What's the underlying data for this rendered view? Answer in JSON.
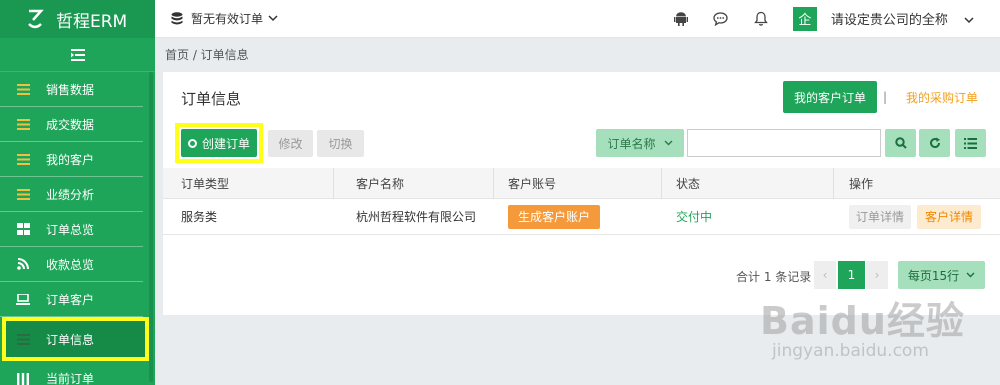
{
  "app": {
    "logo_mark": "ح",
    "logo_text": "哲程ERM"
  },
  "topbar": {
    "orders_label": "暂无有效订单",
    "avatar_char": "企",
    "company_name": "请设定贵公司的全称"
  },
  "sidebar": {
    "items": [
      {
        "label": "销售数据",
        "icon": "menu-lines-icon"
      },
      {
        "label": "成交数据",
        "icon": "menu-lines-icon"
      },
      {
        "label": "我的客户",
        "icon": "menu-lines-icon"
      },
      {
        "label": "业绩分析",
        "icon": "menu-lines-icon"
      },
      {
        "label": "订单总览",
        "icon": "grid-icon"
      },
      {
        "label": "收款总览",
        "icon": "rss-icon"
      },
      {
        "label": "订单客户",
        "icon": "laptop-icon"
      },
      {
        "label": "订单信息",
        "icon": "menu-lines-icon",
        "active": true
      },
      {
        "label": "当前订单",
        "icon": "columns-icon"
      }
    ]
  },
  "breadcrumb": "首页 / 订单信息",
  "panel": {
    "title": "订单信息",
    "my_customer_orders": "我的客户订单",
    "separator": "|",
    "my_purchase_orders": "我的采购订单",
    "create_order": "创建订单",
    "edit": "修改",
    "switch": "切换",
    "search_field": "订单名称",
    "search_value": ""
  },
  "table": {
    "headers": [
      "订单类型",
      "客户名称",
      "客户账号",
      "状态",
      "操作"
    ],
    "rows": [
      {
        "type": "服务类",
        "customer": "杭州哲程软件有限公司",
        "account_action": "生成客户账户",
        "status": "交付中",
        "action_detail": "订单详情",
        "action_customer": "客户详情"
      }
    ]
  },
  "pagination": {
    "total": "合计 1 条记录",
    "prev": "‹",
    "page": "1",
    "next": "›",
    "page_size": "每页15行"
  },
  "watermark": {
    "logo": "Baidu经验",
    "url": "jingyan.baidu.com"
  },
  "colors": {
    "primary": "#1fa55a",
    "highlight": "#ffff1a",
    "orange": "#f59a3a",
    "light_green": "#a5dfbc"
  }
}
